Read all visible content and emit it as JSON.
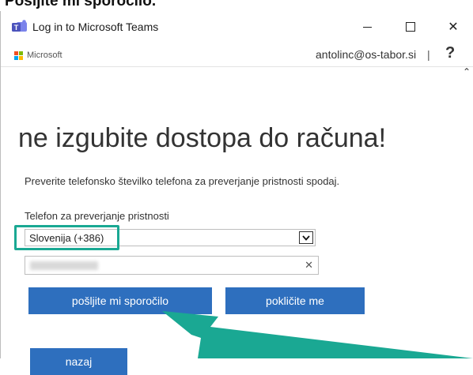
{
  "document": {
    "heading": "Pošljite mi sporočilo."
  },
  "window": {
    "title": "Log in to Microsoft Teams",
    "icon": "teams-icon",
    "controls": {
      "minimize_icon": "minimize-icon",
      "maximize_icon": "maximize-icon",
      "close_icon": "close-icon",
      "close_glyph": "✕"
    }
  },
  "header": {
    "brand": "Microsoft",
    "account": "antolinc@os-tabor.si",
    "separator": "|",
    "help": "?"
  },
  "scrollbar": {
    "up_glyph": "⌃"
  },
  "form": {
    "headline": "ne izgubite dostopa do računa!",
    "instruction": "Preverite telefonsko številko telefona za preverjanje pristnosti spodaj.",
    "phone_label": "Telefon za preverjanje pristnosti",
    "country_value": "Slovenija (+386)",
    "phone_value": "",
    "clear_glyph": "✕",
    "buttons": {
      "send": "pošljite mi sporočilo",
      "call": "pokličite me",
      "back": "nazaj"
    }
  },
  "annotation": {
    "color": "#1aa893"
  },
  "colors": {
    "button": "#2e6fbe",
    "ms_red": "#f25022",
    "ms_green": "#7fba00",
    "ms_blue": "#00a4ef",
    "ms_yellow": "#ffb900"
  }
}
